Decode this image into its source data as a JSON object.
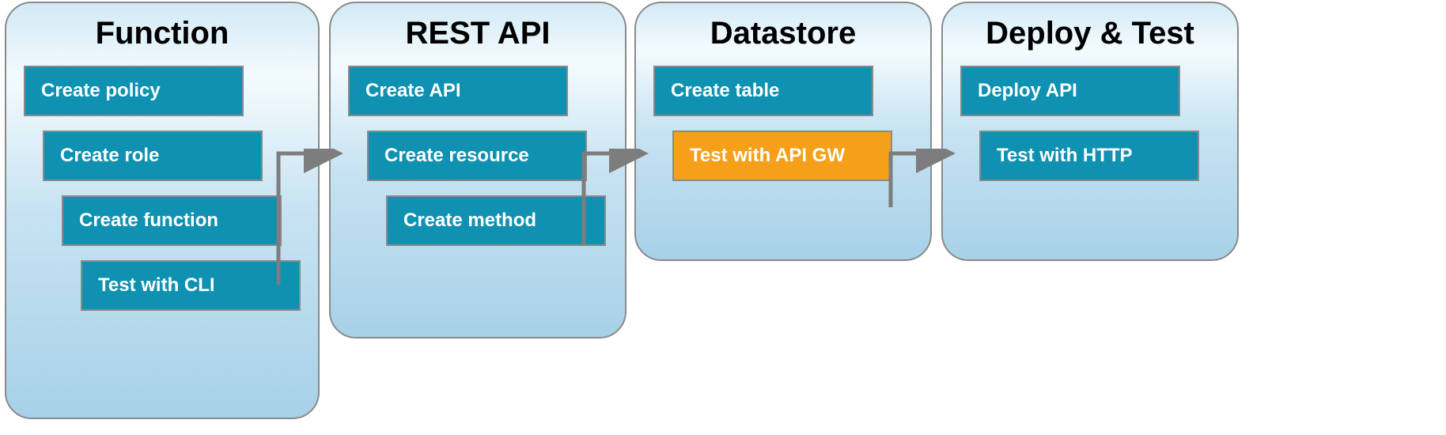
{
  "stages": [
    {
      "id": "function",
      "title": "Function",
      "steps": [
        {
          "label": "Create policy",
          "indent": 0,
          "highlight": false
        },
        {
          "label": "Create role",
          "indent": 1,
          "highlight": false
        },
        {
          "label": "Create function",
          "indent": 2,
          "highlight": false
        },
        {
          "label": "Test with CLI",
          "indent": 3,
          "highlight": false
        }
      ]
    },
    {
      "id": "rest-api",
      "title": "REST API",
      "steps": [
        {
          "label": "Create API",
          "indent": 0,
          "highlight": false
        },
        {
          "label": "Create resource",
          "indent": 1,
          "highlight": false
        },
        {
          "label": "Create method",
          "indent": 2,
          "highlight": false
        }
      ]
    },
    {
      "id": "datastore",
      "title": "Datastore",
      "steps": [
        {
          "label": "Create table",
          "indent": 0,
          "highlight": false
        },
        {
          "label": "Test with API GW",
          "indent": 1,
          "highlight": true
        }
      ]
    },
    {
      "id": "deploy-test",
      "title": "Deploy & Test",
      "steps": [
        {
          "label": "Deploy API",
          "indent": 0,
          "highlight": false
        },
        {
          "label": "Test with HTTP",
          "indent": 1,
          "highlight": false
        }
      ]
    }
  ],
  "colors": {
    "step_bg": "#0f91b2",
    "step_highlight_bg": "#f6a01a",
    "stage_border": "#8a8a8a"
  }
}
